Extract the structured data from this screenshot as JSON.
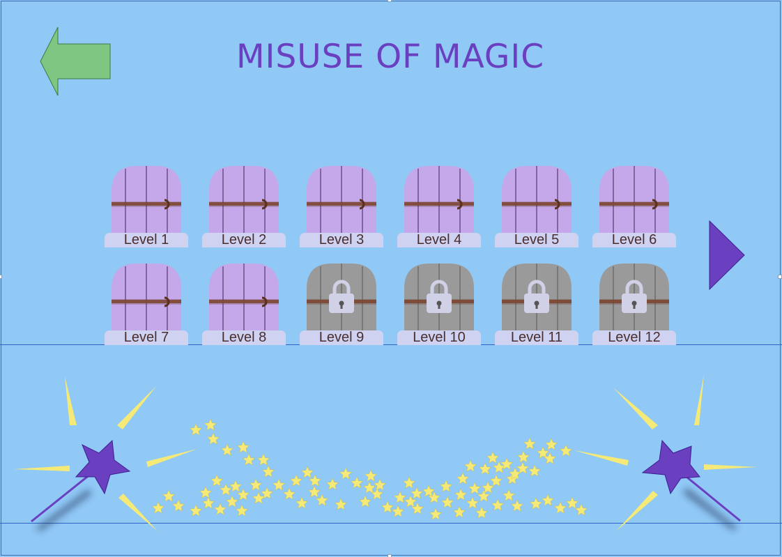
{
  "title": "MISUSE OF MAGIC",
  "icons": {
    "back": "left-arrow-icon",
    "next": "right-triangle-icon",
    "unlocked_door": "door-icon",
    "locked_door": "padlock-icon",
    "wand": "magic-wand-icon",
    "sparkles": "star-icon"
  },
  "colors": {
    "background": "#90c8f6",
    "title": "#6a3fc0",
    "back_arrow": "#7ec681",
    "next_arrow": "#6a3fc0",
    "unlocked_door": "#c5a8ea",
    "locked_door": "#9a9a9a",
    "label_plate": "#cfd2f1",
    "stars": "#f5ea78",
    "wand_star": "#6a3fc0"
  },
  "levels": [
    {
      "label": "Level 1",
      "locked": false
    },
    {
      "label": "Level 2",
      "locked": false
    },
    {
      "label": "Level 3",
      "locked": false
    },
    {
      "label": "Level 4",
      "locked": false
    },
    {
      "label": "Level 5",
      "locked": false
    },
    {
      "label": "Level 6",
      "locked": false
    },
    {
      "label": "Level 7",
      "locked": false
    },
    {
      "label": "Level 8",
      "locked": false
    },
    {
      "label": "Level 9",
      "locked": true
    },
    {
      "label": "Level 10",
      "locked": true
    },
    {
      "label": "Level 11",
      "locked": true
    },
    {
      "label": "Level 12",
      "locked": true
    }
  ]
}
